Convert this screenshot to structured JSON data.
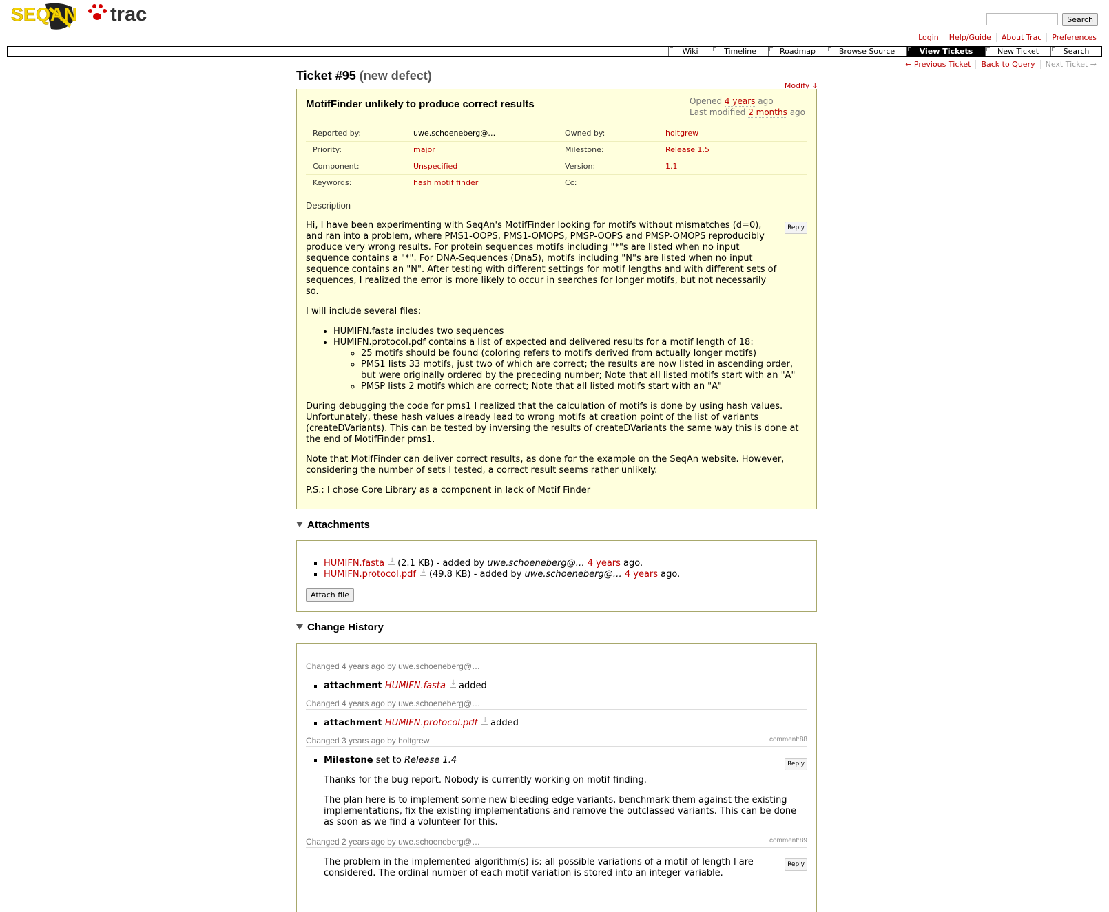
{
  "header": {
    "logo_left": "SEQAN",
    "logo_right": "trac",
    "search_button": "Search",
    "search_placeholder": ""
  },
  "metanav": [
    "Login",
    "Help/Guide",
    "About Trac",
    "Preferences"
  ],
  "mainnav": [
    "Wiki",
    "Timeline",
    "Roadmap",
    "Browse Source",
    "View Tickets",
    "New Ticket",
    "Search"
  ],
  "mainnav_active": "View Tickets",
  "ctxtnav": {
    "prev": "← Previous Ticket",
    "back": "Back to Query",
    "next": "Next Ticket →"
  },
  "ticket": {
    "number": "Ticket #95",
    "status": "(new defect)",
    "modify": "Modify ↓",
    "summary": "MotifFinder unlikely to produce correct results",
    "opened_prefix": "Opened",
    "opened": "4 years",
    "opened_suffix": "ago",
    "modified_prefix": "Last modified",
    "modified": "2 months",
    "modified_suffix": "ago",
    "props": {
      "reported_by_label": "Reported by:",
      "reported_by": "uwe.schoeneberg@…",
      "owned_by_label": "Owned by:",
      "owned_by": "holtgrew",
      "priority_label": "Priority:",
      "priority": "major",
      "milestone_label": "Milestone:",
      "milestone": "Release 1.5",
      "component_label": "Component:",
      "component": "Unspecified",
      "version_label": "Version:",
      "version": "1.1",
      "keywords_label": "Keywords:",
      "keywords": "hash motif finder",
      "cc_label": "Cc:",
      "cc": ""
    },
    "description_label": "Description",
    "reply": "Reply",
    "description": {
      "p1": "Hi, I have been experimenting with SeqAn's MotifFinder looking for motifs without mismatches (d=0), and ran into a problem, where PMS1-OOPS, PMS1-OMOPS, PMSP-OOPS and PMSP-OMOPS reproducibly produce very wrong results. For protein sequences motifs including \"*\"s are listed when no input sequence contains a \"*\". For DNA-Sequences (Dna5), motifs including \"N\"s are listed when no input sequence contains an \"N\". After testing with different settings for motif lengths and with different sets of sequences, I realized the error is more likely to occur in searches for longer motifs, but not necessarily so.",
      "p2": "I will include several files:",
      "li1": "HUMIFN.fasta includes two sequences",
      "li2": "HUMIFN.protocol.pdf contains a list of expected and delivered results for a motif length of 18:",
      "sub1": "25 motifs should be found (coloring refers to motifs derived from actually longer motifs)",
      "sub2": "PMS1 lists 33 motifs, just two of which are correct; the results are now listed in ascending order, but were originally ordered by the preceding number; Note that all listed motifs start with an \"A\"",
      "sub3": "PMSP lists 2 motifs which are correct; Note that all listed motifs start with an \"A\"",
      "p3": "During debugging the code for pms1 I realized that the calculation of motifs is done by using hash values. Unfortunately, these hash values already lead to wrong motifs at creation point of the list of variants (createDVariants). This can be tested by inversing the results of createDVariants the same way this is done at the end of MotifFinder pms1.",
      "p4": "Note that MotifFinder can deliver correct results, as done for the example on the SeqAn website. However, considering the number of sets I tested, a correct result seems rather unlikely.",
      "p5": "P.S.: I chose Core Library as a component in lack of Motif Finder"
    }
  },
  "attachments": {
    "title": "Attachments",
    "items": [
      {
        "name": "HUMIFN.fasta",
        "size": "(2.1 KB)",
        "added_by": "- added by",
        "user": "uwe.schoeneberg@…",
        "age": "4 years",
        "ago": "ago."
      },
      {
        "name": "HUMIFN.protocol.pdf",
        "size": "(49.8 KB)",
        "added_by": "- added by",
        "user": "uwe.schoeneberg@…",
        "age": "4 years",
        "ago": "ago."
      }
    ],
    "attach_button": "Attach file"
  },
  "history": {
    "title": "Change History",
    "changes": [
      {
        "head": "Changed 4 years ago by uwe.schoeneberg@…",
        "field": "attachment",
        "value": "HUMIFN.fasta",
        "action": "added"
      },
      {
        "head": "Changed 4 years ago by uwe.schoeneberg@…",
        "field": "attachment",
        "value": "HUMIFN.protocol.pdf",
        "action": "added"
      },
      {
        "head": "Changed 3 years ago by holtgrew",
        "cid": "comment:88",
        "field": "Milestone",
        "set_to": "set to",
        "value": "Release 1.4",
        "c1": "Thanks for the bug report. Nobody is currently working on motif finding.",
        "c2": "The plan here is to implement some new bleeding edge variants, benchmark them against the existing implementations, fix the existing implementations and remove the outclassed variants. This can be done as soon as we find a volunteer for this."
      },
      {
        "head": "Changed 2 years ago by uwe.schoeneberg@…",
        "cid": "comment:89",
        "c1": "The problem in the implemented algorithm(s) is: all possible variations of a motif of length l are considered. The ordinal number of each motif variation is stored into an integer variable."
      }
    ]
  }
}
